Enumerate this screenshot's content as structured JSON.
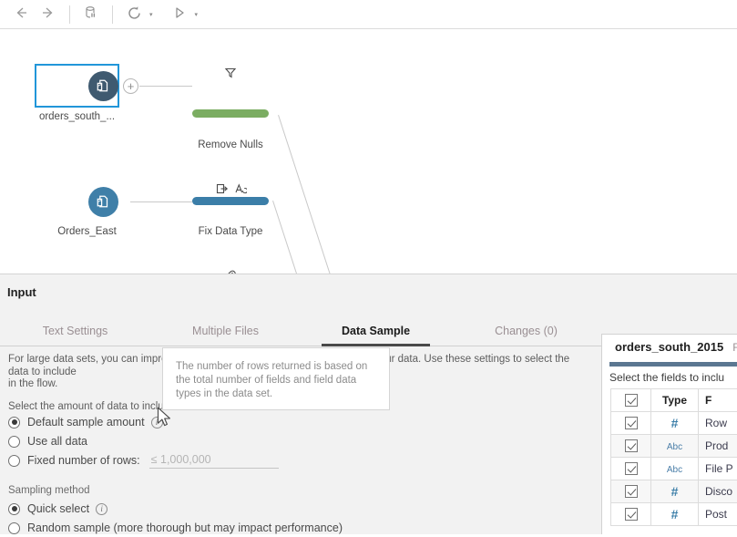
{
  "toolbar": {
    "back": "back-arrow",
    "forward": "forward-arrow",
    "pause_data": "pause-data-icon",
    "refresh": "refresh-icon",
    "run": "run-icon",
    "refresh_caret": "▾",
    "run_caret": "▾"
  },
  "flow": {
    "nodes": [
      {
        "name": "orders_south_...",
        "icon": "input-file-icon",
        "selected": true,
        "circle_color": "#3f5a70"
      },
      {
        "name": "Orders_East",
        "icon": "input-file-icon",
        "selected": false,
        "circle_color": "#3f7fa8"
      },
      {
        "name": "",
        "icon": "input-file-icon",
        "selected": false,
        "circle_color": "#8cc6cc"
      }
    ],
    "steps": [
      {
        "name": "Remove Nulls",
        "color": "#7bad62",
        "icons": [
          "filter-icon"
        ]
      },
      {
        "name": "Fix Data Type",
        "color": "#3b7ea8",
        "icons": [
          "remove-field-icon",
          "change-type-icon"
        ]
      },
      {
        "name": "",
        "color": "#8cc6cc",
        "icons": [
          "paperclip-icon"
        ]
      }
    ],
    "add_step_button": "+"
  },
  "panel": {
    "title": "Input",
    "tabs": [
      {
        "label": "Text Settings",
        "active": false
      },
      {
        "label": "Multiple Files",
        "active": false
      },
      {
        "label": "Data Sample",
        "active": true
      },
      {
        "label": "Changes (0)",
        "active": false
      }
    ],
    "description_line1": "For large data sets, you can improve performance by working with a sample of your data. Use these settings to select the data to include",
    "description_line2": "in the flow.",
    "amount_label": "Select the amount of data to include",
    "amount_options": [
      {
        "label": "Default sample amount",
        "selected": true,
        "info": true
      },
      {
        "label": "Use all data",
        "selected": false,
        "info": false
      },
      {
        "label": "Fixed number of rows:",
        "selected": false,
        "info": false
      }
    ],
    "rows_value": "",
    "rows_placeholder": "≤ 1,000,000",
    "sampling_label": "Sampling method",
    "sampling_options": [
      {
        "label": "Quick select",
        "selected": true,
        "info": true
      },
      {
        "label": "Random sample (more thorough but may impact performance)",
        "selected": false,
        "info": false
      }
    ],
    "info_glyph": "i"
  },
  "tooltip": {
    "text": "The number of rows returned is based on the total number of fields and field data types in the data set."
  },
  "field_panel": {
    "title": "orders_south_2015",
    "tab_label": "Fi",
    "subtitle": "Select the fields to inclu",
    "accent_color": "#5b7791",
    "columns": [
      "",
      "Type",
      "F"
    ],
    "header_checkbox_checked": true,
    "rows": [
      {
        "checked": true,
        "type": "#",
        "type_kind": "number",
        "name": "Row"
      },
      {
        "checked": true,
        "type": "Abc",
        "type_kind": "string",
        "name": "Prod"
      },
      {
        "checked": true,
        "type": "Abc",
        "type_kind": "string",
        "name": "File P"
      },
      {
        "checked": true,
        "type": "#",
        "type_kind": "number",
        "name": "Disco"
      },
      {
        "checked": true,
        "type": "#",
        "type_kind": "number",
        "name": "Post"
      }
    ]
  },
  "cursor": {
    "type": "arrow-pointer"
  }
}
